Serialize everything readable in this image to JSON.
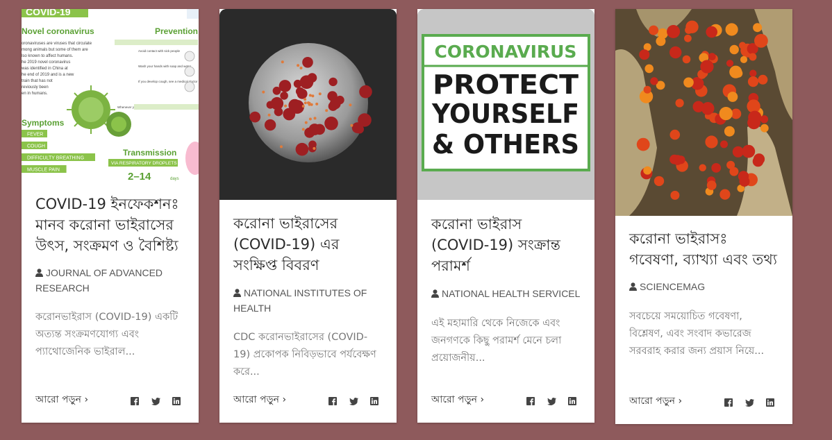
{
  "cards": [
    {
      "title": "COVID-19 ইনফেকশনঃ মানব করোনা ভাইরাসের উৎস, সংক্রমণ ও বৈশিষ্ট্য",
      "source": "JOURNAL OF ADVANCED RESEARCH",
      "excerpt": "করোনভাইরাস (COVID-19) একটি অত্যন্ত সংক্রমণযোগ্য এবং প্যাথোজেনিক ভাইরাল...",
      "read_more": "আরো পড়ুন ›",
      "image": {
        "header": "COVID-19",
        "heading_left": "Novel coronavirus",
        "heading_right": "Prevention",
        "body_lines": [
          "oronaviruses are viruses that circulate",
          "mong animals but some of them are",
          "lso known to affect humans.",
          "he 2019 novel coronavirus",
          "was identified in China at",
          "he end of 2019 and is a new",
          "train that has not",
          "reviously been",
          "en in humans."
        ],
        "symptoms_heading": "Symptoms",
        "symptoms": [
          "FEVER",
          "COUGH",
          "DIFFICULTY BREATHING",
          "MUSCLE PAIN"
        ],
        "transmission_heading": "Transmission",
        "transmission_sub": "VIA RESPIRATORY DROPLETS",
        "days": "2–14",
        "days_suffix": "days",
        "prevention_lines": [
          "When visiting affected areas",
          "Avoid contact with sick people",
          "Wash your hands with soap and water",
          "If you develop cough, see a medical doctor",
          "Whenever you travel apply generally given advice"
        ]
      }
    },
    {
      "title": "করোনা ভাইরাসের (COVID-19) এর সংক্ষিপ্ত বিবরণ",
      "source": "NATIONAL INSTITUTES OF HEALTH",
      "excerpt": "CDC করোনভাইরাসের (COVID-19) প্রকোপক নিবিড়ভাবে পর্যবেক্ষণ করে...",
      "read_more": "আরো পড়ুন ›"
    },
    {
      "title": "করোনা ভাইরাস (COVID-19) সংক্রান্ত পরামর্শ",
      "source": "NATIONAL HEALTH SERVICEL",
      "excerpt": "এই মহামারি থেকে নিজেকে এবং জনগণকে কিছু পরামর্শ মেনে চলা প্রয়োজনীয়...",
      "read_more": "আরো পড়ুন ›",
      "poster": {
        "line1": "CORONAVIRUS",
        "line2": "PROTECT",
        "line3": "YOURSELF",
        "line4": "& OTHERS"
      }
    },
    {
      "title": "করোনা ভাইরাসঃ গবেষণা, ব্যাখ্যা এবং তথ্য",
      "source": "SCIENCEMAG",
      "excerpt": "সবচেয়ে সময়োচিত গবেষণা, বিশ্লেষণ, এবং সংবাদ কভারেজ সরবরাহ করার জন্য প্রয়াস নিয়ে...",
      "read_more": "আরো পড়ুন ›"
    }
  ],
  "colors": {
    "background": "#8e5a5c",
    "card": "#ffffff",
    "title": "#2b2b2b",
    "muted": "#777777",
    "poster_green": "#5aab4f",
    "virus_red": "#9e1f22"
  },
  "icons": [
    "user-icon",
    "facebook-icon",
    "twitter-icon",
    "linkedin-icon"
  ]
}
